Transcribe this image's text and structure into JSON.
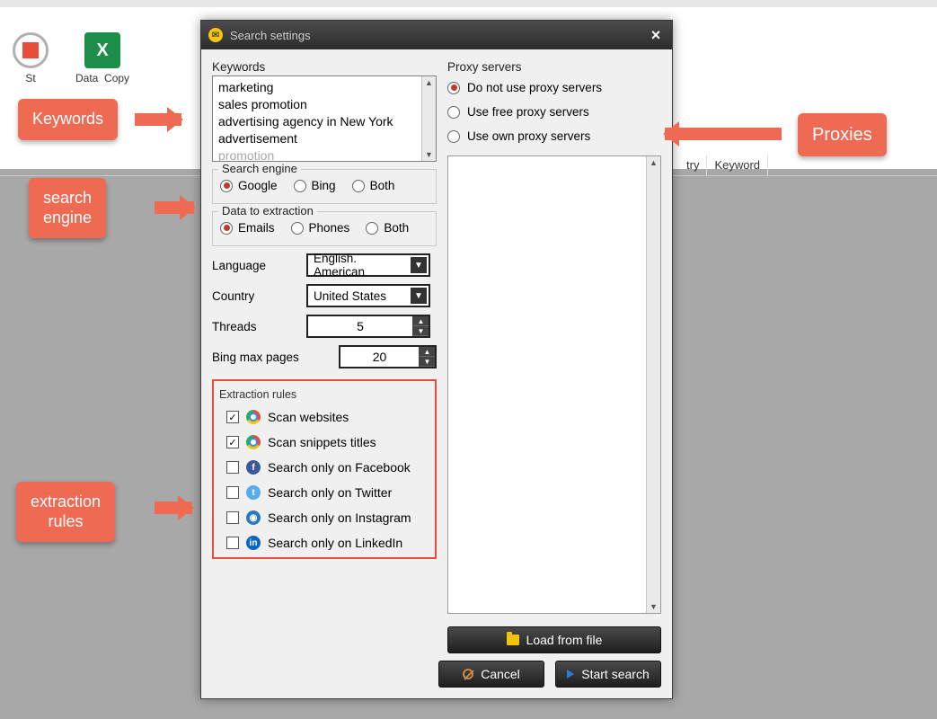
{
  "bg": {
    "stop_label": "St",
    "data_label": "Data",
    "copy_label": "Copy",
    "col_try": "try",
    "col_keyword": "Keyword"
  },
  "dialog": {
    "title": "Search settings",
    "close": "×"
  },
  "keywords": {
    "label": "Keywords",
    "items": [
      "marketing",
      "sales promotion",
      "advertising agency in New York",
      "advertisement",
      "promotion"
    ]
  },
  "search_engine": {
    "label": "Search engine",
    "options": [
      "Google",
      "Bing",
      "Both"
    ],
    "selected": "Google"
  },
  "data_ext": {
    "label": "Data to extraction",
    "options": [
      "Emails",
      "Phones",
      "Both"
    ],
    "selected": "Emails"
  },
  "language": {
    "label": "Language",
    "value": "English. American"
  },
  "country": {
    "label": "Country",
    "value": "United States"
  },
  "threads": {
    "label": "Threads",
    "value": "5"
  },
  "bing": {
    "label": "Bing max pages",
    "value": "20"
  },
  "rules": {
    "label": "Extraction rules",
    "items": [
      {
        "label": "Scan websites",
        "checked": true,
        "icon": "chrome"
      },
      {
        "label": "Scan snippets titles",
        "checked": true,
        "icon": "chrome"
      },
      {
        "label": "Search only on Facebook",
        "checked": false,
        "icon": "fb"
      },
      {
        "label": "Search only on Twitter",
        "checked": false,
        "icon": "tw"
      },
      {
        "label": "Search only on Instagram",
        "checked": false,
        "icon": "ig"
      },
      {
        "label": "Search only on LinkedIn",
        "checked": false,
        "icon": "li"
      }
    ]
  },
  "proxy": {
    "label": "Proxy servers",
    "options": [
      "Do not use proxy servers",
      "Use free proxy servers",
      "Use own proxy servers"
    ],
    "selected": "Do not use proxy servers"
  },
  "buttons": {
    "load": "Load from file",
    "cancel": "Cancel",
    "start": "Start search"
  },
  "callouts": {
    "keywords": "Keywords",
    "search_engine": "search\nengine",
    "extraction_rules": "extraction\nrules",
    "proxies": "Proxies"
  }
}
